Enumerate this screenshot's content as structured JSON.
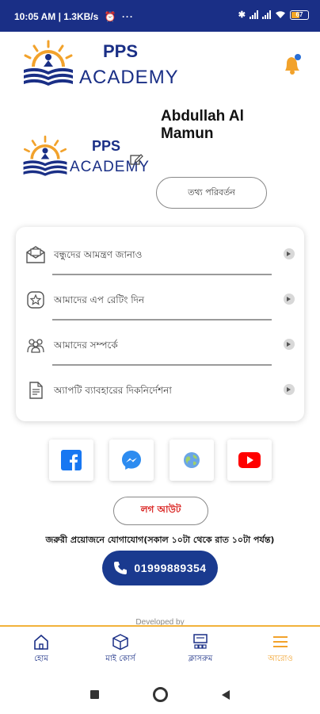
{
  "status_bar": {
    "time_speed": "10:05 AM | 1.3KB/s",
    "more": "···",
    "battery": "67"
  },
  "brand": {
    "name_line1": "PPS",
    "name_line2": "ACADEMY"
  },
  "profile": {
    "name": "Abdullah Al Mamun",
    "edit_button": "তথ্য পরিবর্তন"
  },
  "menu": [
    {
      "label": "বন্ধুদের আমন্ত্রণ জানাও",
      "icon": "invite-envelope-icon"
    },
    {
      "label": "আমাদের এপ রেটিং দিন",
      "icon": "star-rating-icon"
    },
    {
      "label": "আমাদের সম্পর্কে",
      "icon": "about-us-group-icon"
    },
    {
      "label": "অ্যাপটি ব্যাবহারের দিকনির্দেশনা",
      "icon": "guide-document-icon"
    }
  ],
  "social": [
    "facebook-icon",
    "messenger-icon",
    "website-globe-icon",
    "youtube-icon"
  ],
  "logout_label": "লগ আউট",
  "emergency_text": "জরুরী প্রয়োজনে যোগাযোগ(সকাল ১০টা থেকে রাত ১০টা পর্যন্ত)",
  "phone_number": "01999889354",
  "developed_by": "Developed by",
  "bottom_nav": [
    {
      "label": "হোম",
      "icon": "home-icon",
      "active": false
    },
    {
      "label": "মাই কোর্স",
      "icon": "my-course-box-icon",
      "active": false
    },
    {
      "label": "ক্লাসরুম",
      "icon": "classroom-icon",
      "active": false
    },
    {
      "label": "আরোও",
      "icon": "menu-hamburger-icon",
      "active": true
    }
  ],
  "colors": {
    "primary": "#1a2f86",
    "accent": "#f2a22b",
    "logout": "#d9211f",
    "phone_button": "#1a3a8f"
  }
}
